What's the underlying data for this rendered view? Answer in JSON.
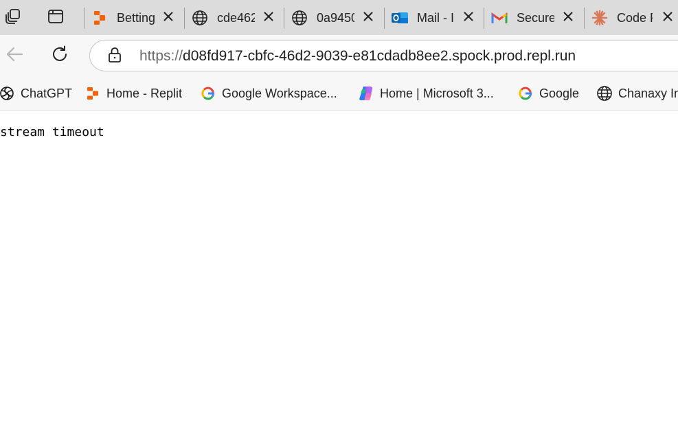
{
  "browser": {
    "tabs": [
      {
        "title": "Betting",
        "icon": "replit-icon"
      },
      {
        "title": "cde462",
        "icon": "globe-icon"
      },
      {
        "title": "0a9450",
        "icon": "globe-icon"
      },
      {
        "title": "Mail - I",
        "icon": "outlook-icon"
      },
      {
        "title": "Secure",
        "icon": "gmail-icon"
      },
      {
        "title": "Code F",
        "icon": "claude-icon"
      }
    ],
    "address": {
      "scheme": "https://",
      "host_and_path": "d08fd917-cbfc-46d2-9039-e81cdadb8ee2.spock.prod.repl.run"
    },
    "bookmarks": [
      {
        "label": "ChatGPT",
        "icon": "chatgpt-icon"
      },
      {
        "label": "Home - Replit",
        "icon": "replit-icon"
      },
      {
        "label": "Google Workspace...",
        "icon": "google-icon"
      },
      {
        "label": "Home | Microsoft 3...",
        "icon": "copilot-icon"
      },
      {
        "label": "Google",
        "icon": "google-icon"
      },
      {
        "label": "Chanaxy In",
        "icon": "globe-icon"
      }
    ]
  },
  "page": {
    "body_text": "stream timeout"
  }
}
